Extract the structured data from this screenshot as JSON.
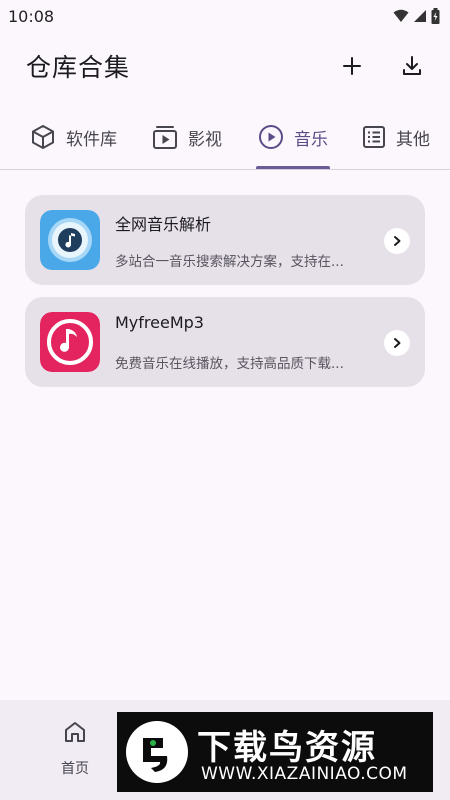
{
  "status_bar": {
    "time": "10:08",
    "icons": [
      "wifi-icon",
      "signal-icon",
      "battery-icon"
    ]
  },
  "app_bar": {
    "title": "仓库合集",
    "actions": [
      "add-icon",
      "download-icon"
    ]
  },
  "tabs": [
    {
      "label": "软件库",
      "icon": "cube-icon",
      "active": false
    },
    {
      "label": "影视",
      "icon": "tv-icon",
      "active": false
    },
    {
      "label": "音乐",
      "icon": "play-circle-icon",
      "active": true
    },
    {
      "label": "其他",
      "icon": "list-icon",
      "active": false
    }
  ],
  "items": [
    {
      "title": "全网音乐解析",
      "description": "多站合一音乐搜索解决方案，支持在...",
      "icon": "music-disc-icon",
      "icon_color": "#4aa8e8"
    },
    {
      "title": "MyfreeMp3",
      "description": "免费音乐在线播放，支持高品质下载...",
      "icon": "music-note-icon",
      "icon_color": "#e4245e"
    }
  ],
  "bottom_nav": {
    "items": [
      {
        "label": "首页",
        "icon": "home-icon"
      }
    ]
  },
  "watermark": {
    "title": "下载鸟资源",
    "url": "WWW.XIAZAINIAO.COM"
  },
  "colors": {
    "accent": "#6a5d96",
    "background": "#fbf7fc",
    "card": "#e6e0e9"
  }
}
